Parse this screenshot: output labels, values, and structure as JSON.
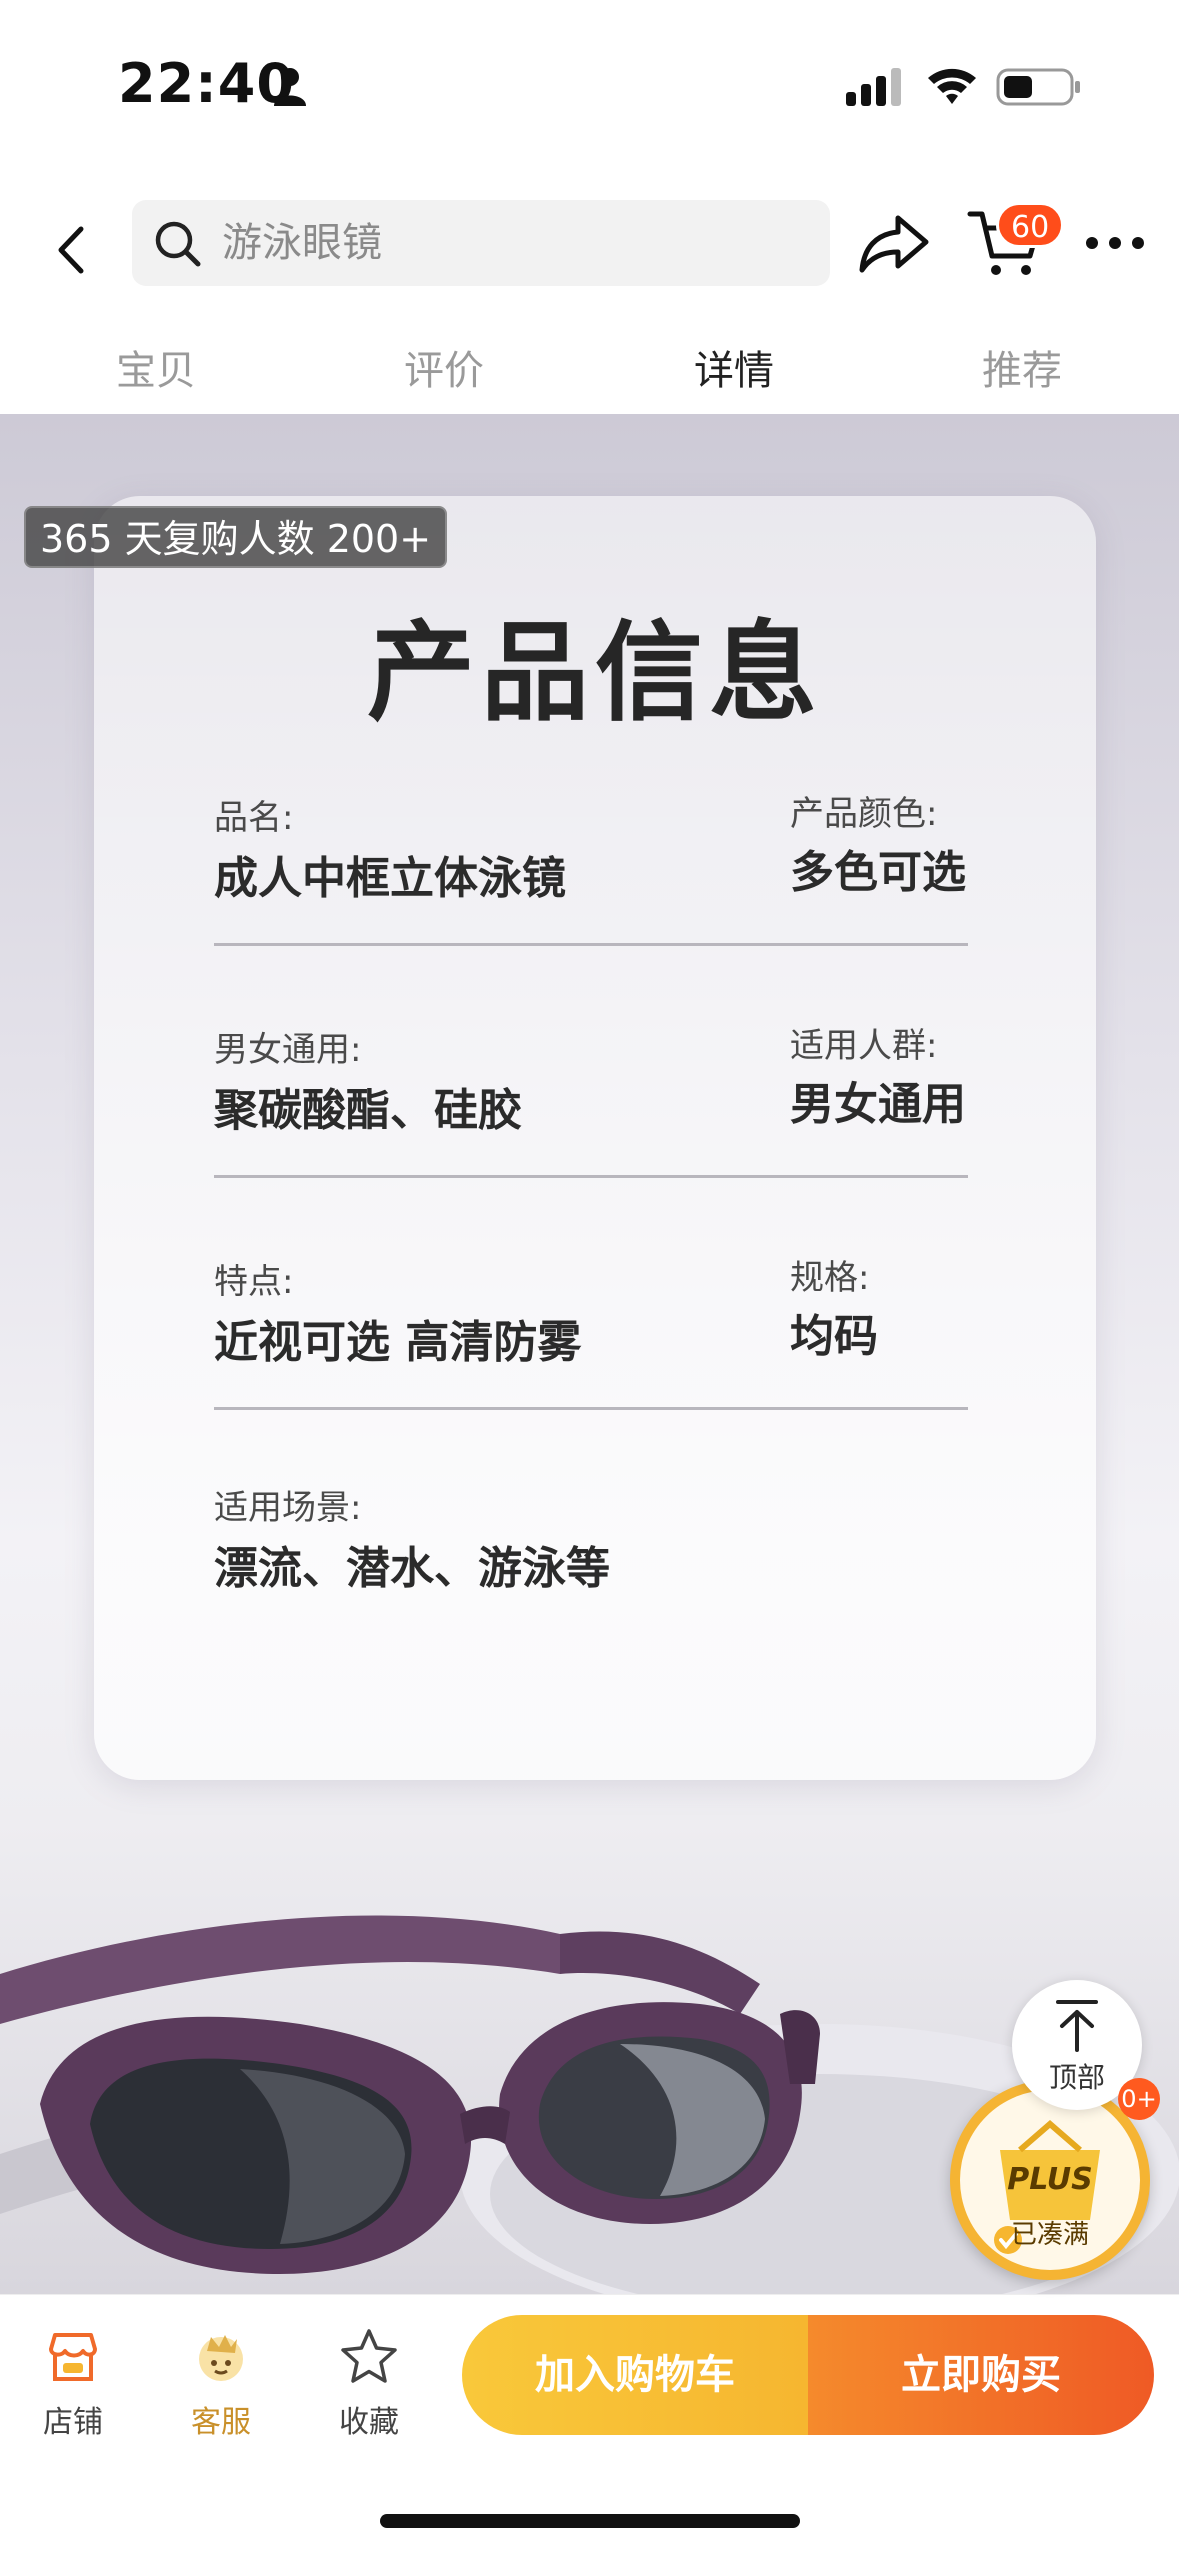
{
  "status_bar": {
    "time": "22:40"
  },
  "header": {
    "search_text": "游泳眼镜",
    "cart_count": "60",
    "tabs": [
      {
        "label": "宝贝"
      },
      {
        "label": "评价"
      },
      {
        "label": "详情"
      },
      {
        "label": "推荐"
      }
    ],
    "active_tab": "详情"
  },
  "content": {
    "repurchase_badge": "365 天复购人数 200+",
    "card_title": "产品信息",
    "rows": [
      {
        "left_label": "品名:",
        "left_value": "成人中框立体泳镜",
        "right_label": "产品颜色:",
        "right_value": "多色可选"
      },
      {
        "left_label": "男女通用:",
        "left_value": "聚碳酸酯、硅胶",
        "right_label": "适用人群:",
        "right_value": "男女通用"
      },
      {
        "left_label": "特点:",
        "left_value": "近视可选 高清防雾",
        "right_label": "规格:",
        "right_value": "均码"
      },
      {
        "left_label": "适用场景:",
        "left_value": "漂流、潜水、游泳等"
      }
    ]
  },
  "floating": {
    "top_label": "顶部",
    "plus_label": "PLUS",
    "plus_status": "已凑满",
    "plus_count": "0+"
  },
  "bottom_bar": {
    "shop_label": "店铺",
    "service_label": "客服",
    "favorite_label": "收藏",
    "add_cart_label": "加入购物车",
    "buy_now_label": "立即购买"
  },
  "colors": {
    "accent_orange": "#ef5a25",
    "accent_yellow": "#f6b630",
    "badge_red": "#ff4d1a"
  }
}
